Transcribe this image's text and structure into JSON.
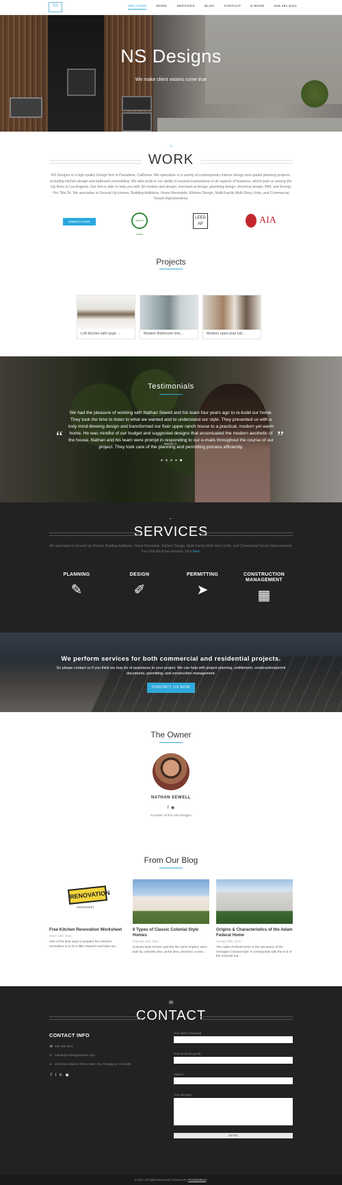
{
  "nav": {
    "logo_text": "NS",
    "links": [
      "WELCOME",
      "WORK",
      "SERVICES",
      "BLOG",
      "CONTACT",
      "E-BOOK",
      "626-491-9411"
    ]
  },
  "hero": {
    "title": "NS Designs",
    "tagline": "We make client visions come true"
  },
  "work": {
    "title": "WORK",
    "body": "NS Designs is a high quality Design firm in Pasadena, California. We specialize in a variety of contemporary interior design and spatial planning projects, including kitchen design and bathroom remodeling. We take pride in our ability to exceed expectations in all aspects of business, which puts us among the top firms in Los Angeles. Our firm is able to help you with 3D models and design, mechanical design, plumbing design, electrical design, BIM, and Energy Pro Title 24. We specialize in Ground Up Homes, Building Additions, Home Remodels, Kitchen Design, Multi-Family Multi-Story Units, and Commercial Tenant Improvements.",
    "logos": [
      "ENERGY STAR",
      "Build It Green",
      "LEED AP",
      "AIA"
    ]
  },
  "projects": {
    "title": "Projects",
    "items": [
      {
        "caption": "Loft kitchen with large ..."
      },
      {
        "caption": "Modern Bathroom Inte..."
      },
      {
        "caption": "Modern open plan kitc..."
      }
    ]
  },
  "testimonials": {
    "title": "Testimonials",
    "quote": "We had the pleasure of working with Nathan Sewell and his team four years ago to re-build our home. They took the time to listen to what we wanted and to understand our style. They presented us with a truly mind-blowing design and transformed our fixer upper ranch house to a practical, modern yet warm home. He was mindful of our budget and suggested designs that accentuated the modern aesthetic of the house. Nathan and his team were prompt in responding to our e-mails throughout the course of our project. They took care of the planning and permitting process efficiently.",
    "author": "Marion C.",
    "open_quote": "“",
    "close_quote": "”",
    "active_dot": 4
  },
  "services": {
    "title": "SERVICES",
    "desc": "We specialize in Ground Up Homes, Building Additions, Home Remodels, Kitchen Design, Multi-Family Multi-Story Units, and Commercial Tenant Improvements. For a full list of our services, click ",
    "desc_link": "here.",
    "items": [
      {
        "label": "PLANNING",
        "icon": "edit-icon",
        "glyph": "✎"
      },
      {
        "label": "DESIGN",
        "icon": "brush-icon",
        "glyph": "✐"
      },
      {
        "label": "PERMITTING",
        "icon": "paper-plane-icon",
        "glyph": "➤"
      },
      {
        "label": "CONSTRUCTION MANAGEMENT",
        "icon": "building-icon",
        "glyph": "▦"
      }
    ]
  },
  "cta": {
    "heading": "We perform services for both commercial and residential projects.",
    "body": "So please contact us if you think we may be of assistance to your project. We can help with project planning, entitlement, construction/permit documents, permitting, and construction management.",
    "button": "CONTACT US NOW"
  },
  "owner": {
    "title": "The Owner",
    "name": "NATHAN SEWELL",
    "role": "Founder of firm NS Designs"
  },
  "blog": {
    "title": "From Our Blog",
    "posts": [
      {
        "title": "Free Kitchen Renovation Worksheet",
        "date": "March 16th, 2018",
        "excerpt": "One of the best ways to prepare for a kitchen renovation is to do a little research and dare we..."
      },
      {
        "title": "6 Types of Classic Colonial Style Homes",
        "date": "February 19th, 2018",
        "excerpt": "Colonial style homes, just like the name implies, were built by colonists who, at the time, arrived in a new..."
      },
      {
        "title": "Origins & Characteristics of the Adam Federal Home",
        "date": "January 30th, 2018",
        "excerpt": "The Adam-Federal home is the successor of the Georgian Colonial style. It corresponds with the end of the Colonial era..."
      }
    ],
    "sign_text": "RENOVATION",
    "sign_sub": "WORKSHEET"
  },
  "contact": {
    "title": "CONTACT",
    "info_title": "CONTACT INFO",
    "phone": "626-491-9411",
    "email": "nathan@nsdesignsonline.com",
    "address": "1245 East Walnut Street, Suite 116, Pasadena, CA 91106",
    "form": {
      "name_label": "Your Name (required)",
      "email_label": "Your Email (required)",
      "subject_label": "Subject",
      "message_label": "Your Message",
      "send": "SEND"
    }
  },
  "footer": {
    "text": "© 2017 All Rights Reserved | Powered by ",
    "link": "ThunderSkout",
    "suffix": " |"
  }
}
